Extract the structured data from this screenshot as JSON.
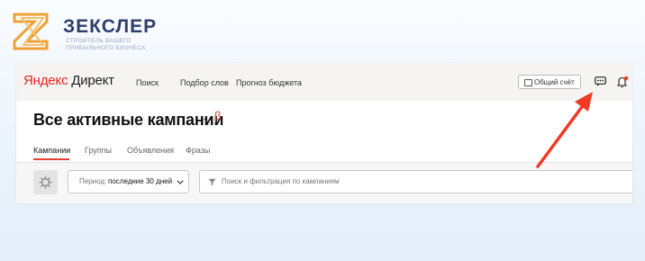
{
  "logo": {
    "title": "ЗЕКСЛЕР",
    "subtitle": "СТРОИТЕЛЬ ВАШЕГО ПРИБЫЛЬНОГО БИЗНЕСА"
  },
  "header": {
    "brand_first": "Яндекс",
    "brand_second": "Директ",
    "nav": [
      "Поиск",
      "Подбор слов",
      "Прогноз бюджета"
    ],
    "account_button": "Общий счёт"
  },
  "page": {
    "title": "Все активные кампании",
    "beta_mark": "β"
  },
  "tabs": [
    "Кампании",
    "Группы",
    "Объявления",
    "Фразы"
  ],
  "filters": {
    "period_label": "Период:",
    "period_value": "последние 30 дней",
    "search_placeholder": "Поиск и фильтрация по кампаниям"
  },
  "colors": {
    "accent_red": "#e73f33",
    "annotation_arrow": "#f13a26",
    "logo_orange": "#f0a033"
  }
}
